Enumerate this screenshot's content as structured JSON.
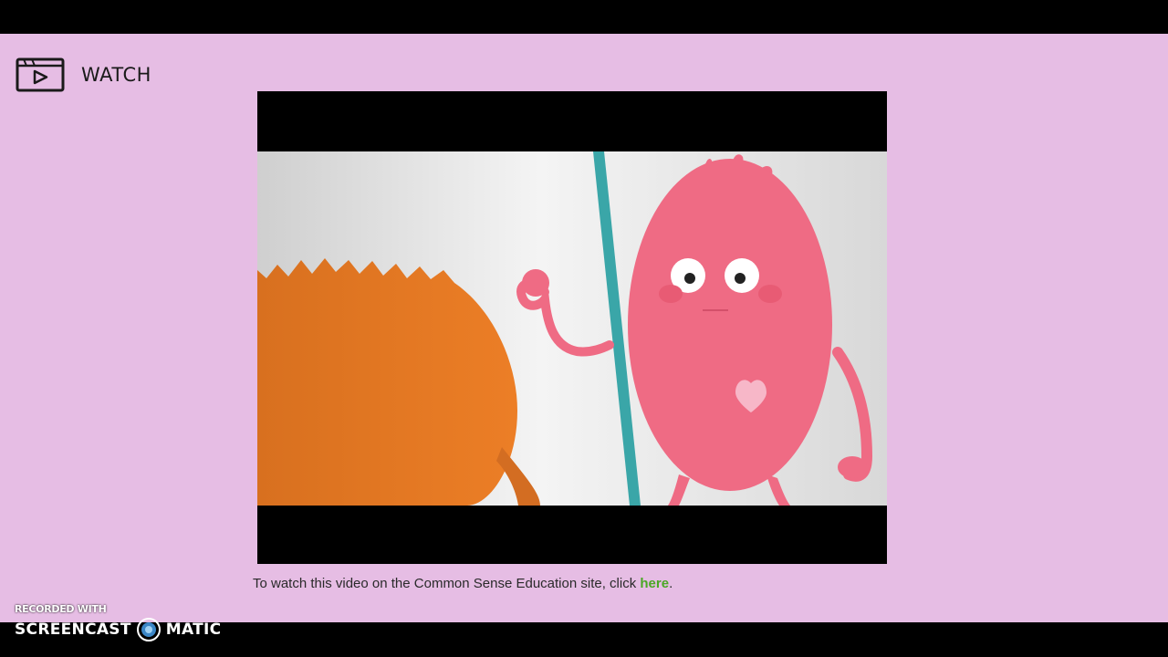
{
  "header": {
    "section_label": "WATCH",
    "icon": "video-player-icon"
  },
  "video": {
    "icon": "video-frame"
  },
  "caption": {
    "text": "To watch this video on the Common Sense Education site, click ",
    "link_label": "here",
    "suffix": "."
  },
  "watermark": {
    "recorded": "RECORDED WITH",
    "brand_left": "SCREENCAST",
    "brand_right": "MATIC"
  },
  "colors": {
    "page_background": "#e6bde4",
    "link": "#4aa824",
    "orange_character": "#e57c28",
    "pink_character": "#ef6b84",
    "pole": "#3aa6a8"
  }
}
